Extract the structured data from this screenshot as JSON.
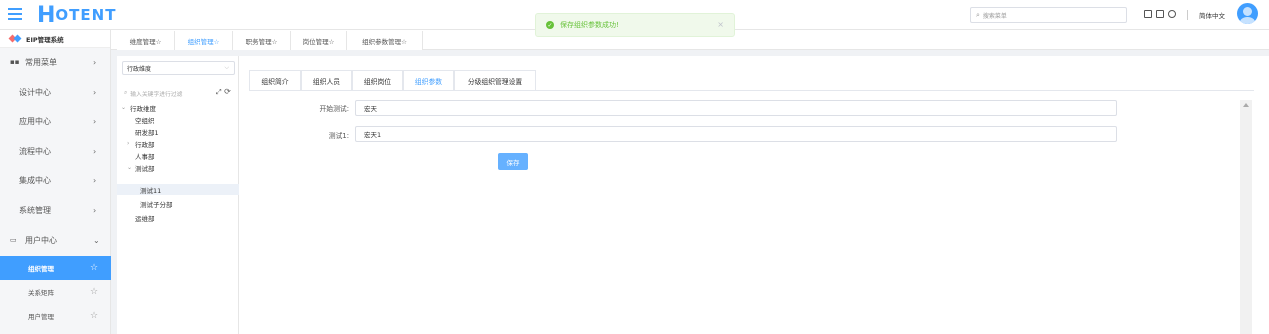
{
  "app": {
    "logo_text": "OTENT",
    "logo_letter": "H",
    "system_name": "EIP管理系统"
  },
  "toast": {
    "message": "保存组织参数成功!",
    "close": "×"
  },
  "header": {
    "search_placeholder": "搜索菜单",
    "language": "简体中文"
  },
  "sidebar": {
    "items": [
      {
        "label": "常用菜单",
        "arrow": "›"
      },
      {
        "label": "设计中心",
        "arrow": "›"
      },
      {
        "label": "应用中心",
        "arrow": "›"
      },
      {
        "label": "流程中心",
        "arrow": "›"
      },
      {
        "label": "集成中心",
        "arrow": "›"
      },
      {
        "label": "系统管理",
        "arrow": "›"
      },
      {
        "label": "用户中心",
        "arrow": "⌄"
      }
    ],
    "sub_items": [
      {
        "label": "组织管理",
        "star": "☆",
        "active": true
      },
      {
        "label": "关系矩阵",
        "star": "☆"
      },
      {
        "label": "用户管理",
        "star": "☆"
      }
    ]
  },
  "tabs": [
    {
      "label": "维度管理☆"
    },
    {
      "label": "组织管理☆"
    },
    {
      "label": "职务管理☆"
    },
    {
      "label": "岗位管理☆"
    },
    {
      "label": "组织参数管理☆"
    }
  ],
  "tree": {
    "dimension": "行政维度",
    "filter_placeholder": "输入关键字进行过滤",
    "nodes": [
      {
        "label": "行政维度",
        "toggle": "⌄"
      },
      {
        "label": "空组织"
      },
      {
        "label": "研发部1"
      },
      {
        "label": "行政部",
        "toggle": "›"
      },
      {
        "label": "人事部"
      },
      {
        "label": "测试部",
        "toggle": "⌄"
      },
      {
        "label": "测试11",
        "selected": true
      },
      {
        "label": "测试子分部"
      },
      {
        "label": "运维部"
      }
    ]
  },
  "main": {
    "subtabs": [
      {
        "label": "组织简介"
      },
      {
        "label": "组织人员"
      },
      {
        "label": "组织岗位"
      },
      {
        "label": "组织参数"
      },
      {
        "label": "分级组织管理设置"
      }
    ],
    "fields": [
      {
        "label": "开始测试:",
        "value": "宏天"
      },
      {
        "label": "测试1:",
        "value": "宏天1"
      }
    ],
    "save_label": "保存"
  },
  "colors": {
    "accent": "#409eff",
    "success": "#67c23a"
  }
}
